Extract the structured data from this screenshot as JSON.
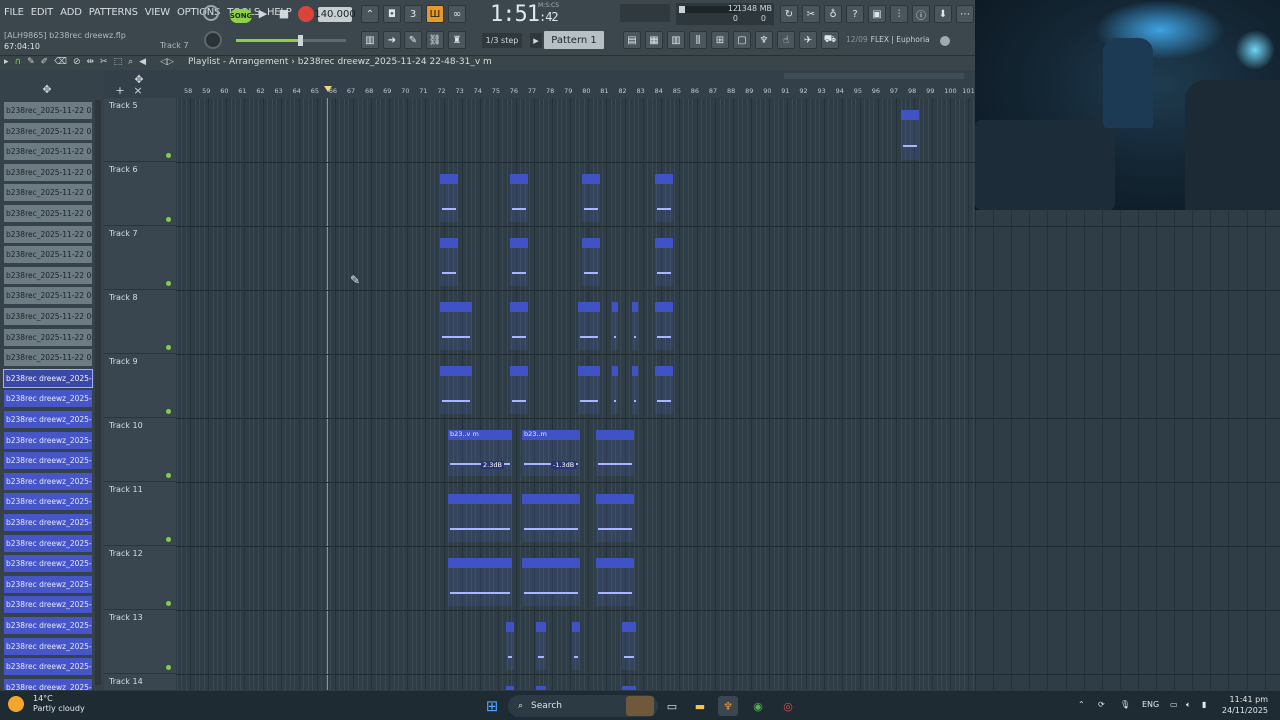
{
  "menu": [
    "FILE",
    "EDIT",
    "ADD",
    "PATTERNS",
    "VIEW",
    "OPTIONS",
    "TOOLS",
    "HELP"
  ],
  "transport": {
    "mode": "SONG",
    "tempo": "140.000",
    "time": "1:51",
    "time_sub": ":42",
    "time_unit": "M:S:CS"
  },
  "monitor": {
    "a": "12",
    "b": "0",
    "mem": "1348 MB",
    "c": "0"
  },
  "hint": {
    "line1": "[ALH9865] b238rec dreewz.flp",
    "line2": "67:04:10",
    "track": "Track 7"
  },
  "snap": "1/3 step",
  "pattern": "Pattern 1",
  "plugin": {
    "index": "12/09",
    "name": "FLEX | Euphoria"
  },
  "playlist": {
    "title": "Playlist - Arrangement",
    "breadcrumb": "b238rec dreewz_2025-11-24 22-48-31_v m"
  },
  "picker": {
    "gray_items": [
      "b238rec_2025-11-22 05-...",
      "b238rec_2025-11-22 05-...",
      "b238rec_2025-11-22 06-...",
      "b238rec_2025-11-22 06-...",
      "b238rec_2025-11-22 06-...",
      "b238rec_2025-11-22 06-...",
      "b238rec_2025-11-22 06-...",
      "b238rec_2025-11-22 06-...",
      "b238rec_2025-11-22 06-...",
      "b238rec_2025-11-22 06-...",
      "b238rec_2025-11-22 06-...",
      "b238rec_2025-11-22 06-...",
      "b238rec_2025-11-22 06-..."
    ],
    "selected": "b238rec dreewz_2025-11...",
    "blue_items": [
      "b238rec dreewz_2025-11...",
      "b238rec dreewz_2025-11...",
      "b238rec dreewz_2025-11...",
      "b238rec dreewz_2025-11...",
      "b238rec dreewz_2025-11...",
      "b238rec dreewz_2025-11...",
      "b238rec dreewz_2025-11...",
      "b238rec dreewz_2025-11...",
      "b238rec dreewz_2025-11...",
      "b238rec dreewz_2025-11...",
      "b238rec dreewz_2025-11...",
      "b238rec dreewz_2025-11...",
      "b238rec dreewz_2025-11...",
      "b238rec dreewz_2025-11...",
      "b238rec dreewz_2025-11..."
    ]
  },
  "ruler": [
    "58",
    "59",
    "60",
    "61",
    "62",
    "63",
    "64",
    "65",
    "66",
    "67",
    "68",
    "69",
    "70",
    "71",
    "72",
    "73",
    "74",
    "75",
    "76",
    "77",
    "78",
    "79",
    "80",
    "81",
    "82",
    "83",
    "84",
    "85",
    "86",
    "87",
    "88",
    "89",
    "90",
    "91",
    "92",
    "93",
    "94",
    "95",
    "96",
    "97",
    "98",
    "99",
    "100",
    "101"
  ],
  "tracks": [
    "Track 5",
    "Track 6",
    "Track 7",
    "Track 8",
    "Track 9",
    "Track 10",
    "Track 11",
    "Track 12",
    "Track 13",
    "Track 14"
  ],
  "clips": {
    "track10_label_a": "b23..v m",
    "track10_label_b": "b23..m",
    "gain_a": "2.3dB",
    "gain_b": "-1.3dB"
  },
  "taskbar": {
    "temp": "14°C",
    "weather": "Partly cloudy",
    "search": "Search",
    "lang": "ENG",
    "time": "11:41 pm",
    "date": "24/11/2025"
  }
}
